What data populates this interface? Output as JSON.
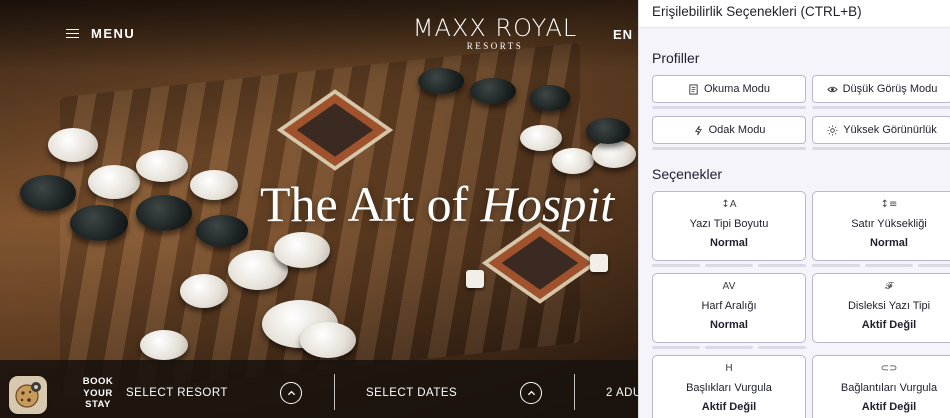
{
  "header": {
    "menu_label": "MENU",
    "logo_line1": "MAXX ROYAL",
    "logo_line2": "RESORTS",
    "lang": "EN"
  },
  "hero": {
    "headline_plain": "The Art of ",
    "headline_italic": "Hospit"
  },
  "booking": {
    "book_line1": "BOOK",
    "book_line2": "YOUR",
    "book_line3": "STAY",
    "select_resort": "SELECT RESORT",
    "select_dates": "SELECT DATES",
    "guests": "2 ADU"
  },
  "accessibility": {
    "title": "Erişilebilirlik Seçenekleri (CTRL+B)",
    "profiles_title": "Profiller",
    "profiles": [
      {
        "label": "Okuma Modu",
        "icon": "document-icon"
      },
      {
        "label": "Düşük Görüş Modu",
        "icon": "eye-icon"
      },
      {
        "label": "Odak Modu",
        "icon": "lightning-icon"
      },
      {
        "label": "Yüksek Görünürlük",
        "icon": "sun-icon"
      }
    ],
    "options_title": "Seçenekler",
    "options": [
      {
        "icon_text": "↕A",
        "icon": "font-size-icon",
        "name": "Yazı Tipi Boyutu",
        "state": "Normal"
      },
      {
        "icon_text": "↕≡",
        "icon": "line-height-icon",
        "name": "Satır Yüksekliği",
        "state": "Normal"
      },
      {
        "icon_text": "AV",
        "icon": "letter-spacing-icon",
        "name": "Harf Aralığı",
        "state": "Normal"
      },
      {
        "icon_text": "𝓕",
        "icon": "dyslexia-font-icon",
        "name": "Disleksi Yazı Tipi",
        "state": "Aktif Değil"
      },
      {
        "icon_text": "H",
        "icon": "heading-icon",
        "name": "Başlıkları Vurgula",
        "state": "Aktif Değil"
      },
      {
        "icon_text": "⊂⊃",
        "icon": "link-icon",
        "name": "Bağlantıları Vurgula",
        "state": "Aktif Değil"
      }
    ]
  },
  "colors": {
    "panel_bg": "#f6f4fb",
    "card_border": "#b9b6cf",
    "bar_bg": "#19120e"
  }
}
